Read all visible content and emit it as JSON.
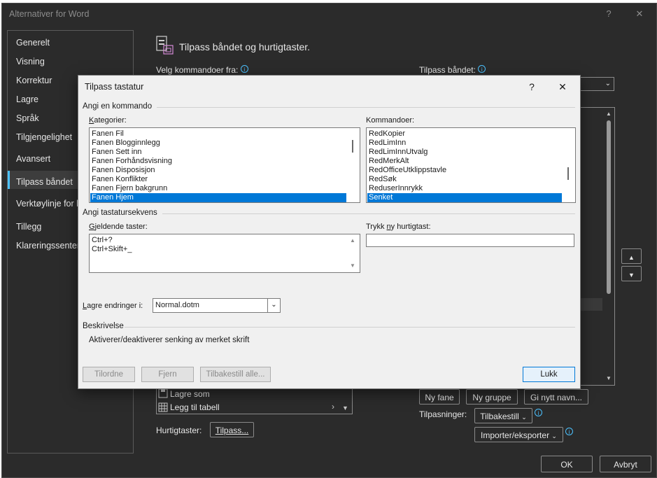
{
  "outer": {
    "title": "Alternativer for Word",
    "help": "?",
    "close": "✕"
  },
  "nav": {
    "items": [
      {
        "label": "Generelt"
      },
      {
        "label": "Visning"
      },
      {
        "label": "Korrektur"
      },
      {
        "label": "Lagre"
      },
      {
        "label": "Språk"
      },
      {
        "label": "Tilgjengelighet"
      },
      {
        "label": "Avansert"
      },
      {
        "label": "Tilpass båndet"
      },
      {
        "label": "Verktøylinje for h"
      },
      {
        "label": "Tillegg"
      },
      {
        "label": "Klareringssenter"
      }
    ],
    "selected": "Tilpass båndet"
  },
  "main": {
    "heading": "Tilpass båndet og hurtigtaster.",
    "choose_from_label": "Velg kommandoer fra:",
    "customize_ribbon_label": "Tilpass båndet:",
    "bg_list": [
      {
        "label": "Lagre som"
      },
      {
        "label": "Legg til tabell"
      }
    ],
    "shortcuts_label": "Hurtigtaster:",
    "customize_button": "Tilpass...",
    "new_tab": "Ny fane",
    "new_group": "Ny gruppe",
    "rename": "Gi nytt navn...",
    "customizations_label": "Tilpasninger:",
    "reset_button": "Tilbakestill",
    "import_export_button": "Importer/eksporter",
    "ok": "OK",
    "cancel": "Avbryt"
  },
  "dialog": {
    "title": "Tilpass tastatur",
    "help": "?",
    "close": "✕",
    "specify_command": "Angi en kommando",
    "categories_label": "Kategorier:",
    "categories": [
      "Fanen Fil",
      "Fanen Blogginnlegg",
      "Fanen Sett inn",
      "Fanen Forhåndsvisning",
      "Fanen Disposisjon",
      "Fanen Konflikter",
      "Fanen Fjern bakgrunn",
      "Fanen Hjem"
    ],
    "selected_category": "Fanen Hjem",
    "commands_label": "Kommandoer:",
    "commands": [
      "RedKopier",
      "RedLimInn",
      "RedLimInnUtvalg",
      "RedMerkAlt",
      "RedOfficeUtklippstavle",
      "RedSøk",
      "ReduserInnrykk",
      "Senket"
    ],
    "selected_command": "Senket",
    "key_sequence": "Angi tastatursekvens",
    "current_keys_label": "Gjeldende taster:",
    "current_keys": [
      "Ctrl+?",
      "Ctrl+Skift+_"
    ],
    "new_shortcut_label": "Trykk ny hurtigtast:",
    "new_shortcut_value": "",
    "save_changes_label": "Lagre endringer i:",
    "save_changes_value": "Normal.dotm",
    "description_heading": "Beskrivelse",
    "description_text": "Aktiverer/deaktiverer senking av merket skrift",
    "assign": "Tilordne",
    "remove": "Fjern",
    "reset_all": "Tilbakestill alle...",
    "close_button": "Lukk"
  },
  "colors": {
    "accent": "#0078d7",
    "dark_bg": "#2b2b2b",
    "dialog_bg": "#f0f0f0",
    "info_blue": "#4cc2ff"
  }
}
